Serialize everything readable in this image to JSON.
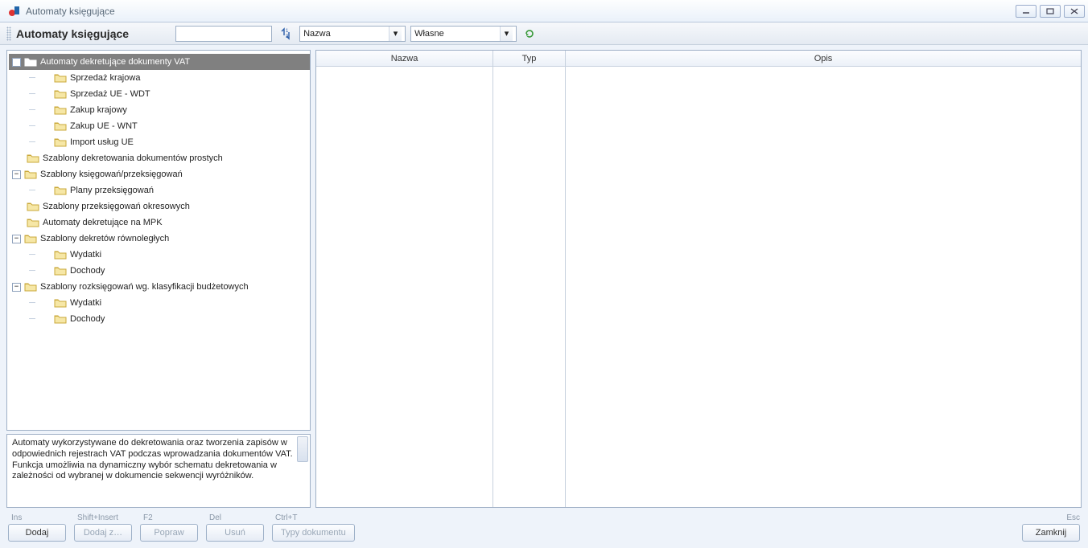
{
  "window": {
    "title": "Automaty księgujące"
  },
  "header": {
    "title": "Automaty księgujące",
    "combo1": "Nazwa",
    "combo2": "Własne"
  },
  "tree": [
    {
      "label": "Automaty dekretujące dokumenty VAT",
      "expanded": true,
      "selected": true,
      "children": [
        {
          "label": "Sprzedaż krajowa"
        },
        {
          "label": "Sprzedaż UE - WDT"
        },
        {
          "label": "Zakup krajowy"
        },
        {
          "label": "Zakup UE - WNT"
        },
        {
          "label": "Import usług UE"
        }
      ]
    },
    {
      "label": "Szablony dekretowania dokumentów prostych",
      "leafish": true
    },
    {
      "label": "Szablony księgowań/przeksięgowań",
      "expanded": true,
      "children": [
        {
          "label": "Plany przeksięgowań"
        }
      ]
    },
    {
      "label": "Szablony przeksięgowań okresowych",
      "leafish": true
    },
    {
      "label": "Automaty dekretujące na MPK",
      "leafish": true
    },
    {
      "label": "Szablony dekretów równoległych",
      "expanded": true,
      "children": [
        {
          "label": "Wydatki"
        },
        {
          "label": "Dochody"
        }
      ]
    },
    {
      "label": "Szablony rozksięgowań wg. klasyfikacji budżetowych",
      "expanded": true,
      "children": [
        {
          "label": "Wydatki"
        },
        {
          "label": "Dochody"
        }
      ]
    }
  ],
  "description": "Automaty wykorzystywane do dekretowania oraz tworzenia zapisów w odpowiednich rejestrach VAT podczas wprowadzania dokumentów VAT. Funkcja umożliwia na dynamiczny wybór schematu dekretowania w zależności od wybranej w dokumencie sekwencji wyróżników.",
  "table": {
    "columns": {
      "nazwa": "Nazwa",
      "typ": "Typ",
      "opis": "Opis"
    }
  },
  "buttons": {
    "dodaj": {
      "shortcut": "Ins",
      "label": "Dodaj"
    },
    "dodajz": {
      "shortcut": "Shift+Insert",
      "label": "Dodaj z…"
    },
    "popraw": {
      "shortcut": "F2",
      "label": "Popraw"
    },
    "usun": {
      "shortcut": "Del",
      "label": "Usuń"
    },
    "typy": {
      "shortcut": "Ctrl+T",
      "label": "Typy dokumentu"
    },
    "zamknij": {
      "shortcut": "Esc",
      "label": "Zamknij"
    }
  }
}
